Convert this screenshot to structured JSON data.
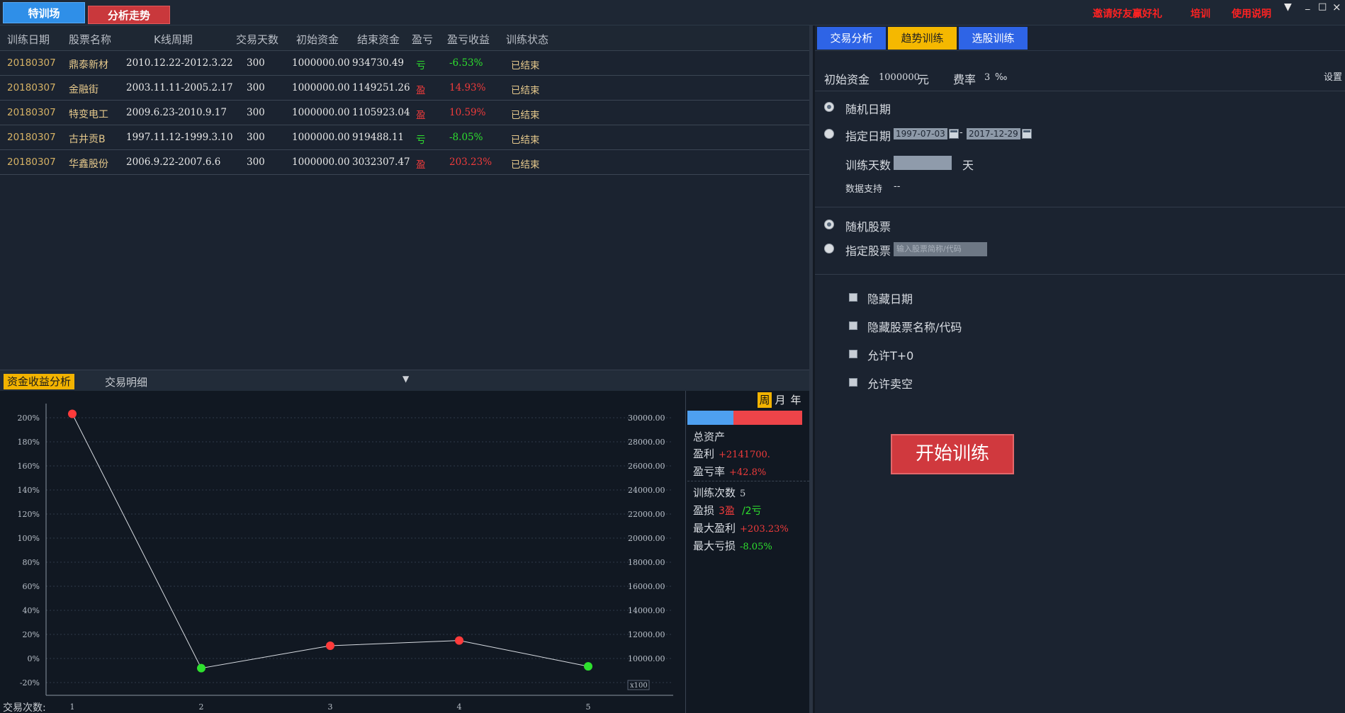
{
  "topbar": {
    "tab_trainer": "特训场",
    "tab_analysis": "分析走势",
    "link_invite": "邀请好友赢好礼",
    "link_training": "培训",
    "link_manual": "使用说明",
    "menu_icon": "chevron-down-icon",
    "minimize": "_",
    "maximize": "□",
    "close": "×"
  },
  "table": {
    "headers": [
      "训练日期",
      "股票名称",
      "K线周期",
      "交易天数",
      "初始资金",
      "结束资金",
      "盈亏",
      "盈亏收益",
      "训练状态"
    ],
    "rows": [
      {
        "date": "20180307",
        "name": "鼎泰新材",
        "period": "2010.12.22-2012.3.22",
        "days": "300",
        "init": "1000000.00",
        "end": "934730.49",
        "pl": "亏",
        "ret": "-6.53%",
        "status": "已结束"
      },
      {
        "date": "20180307",
        "name": "金融街",
        "period": "2003.11.11-2005.2.17",
        "days": "300",
        "init": "1000000.00",
        "end": "1149251.26",
        "pl": "盈",
        "ret": "14.93%",
        "status": "已结束"
      },
      {
        "date": "20180307",
        "name": "特变电工",
        "period": "2009.6.23-2010.9.17",
        "days": "300",
        "init": "1000000.00",
        "end": "1105923.04",
        "pl": "盈",
        "ret": "10.59%",
        "status": "已结束"
      },
      {
        "date": "20180307",
        "name": "古井贡B",
        "period": "1997.11.12-1999.3.10",
        "days": "300",
        "init": "1000000.00",
        "end": "919488.11",
        "pl": "亏",
        "ret": "-8.05%",
        "status": "已结束"
      },
      {
        "date": "20180307",
        "name": "华鑫股份",
        "period": "2006.9.22-2007.6.6",
        "days": "300",
        "init": "1000000.00",
        "end": "3032307.47",
        "pl": "盈",
        "ret": "203.23%",
        "status": "已结束"
      }
    ]
  },
  "bottom_tabs": {
    "fund_analysis": "资金收益分析",
    "trade_detail": "交易明细"
  },
  "chart_data": {
    "type": "line",
    "x": [
      1,
      2,
      3,
      4,
      5
    ],
    "values": [
      203.23,
      -8.05,
      10.59,
      14.93,
      -6.53
    ],
    "point_colors": [
      "#ff3b3b",
      "#2ee02e",
      "#ff3b3b",
      "#ff3b3b",
      "#2ee02e"
    ],
    "y_ticks_left": [
      "200%",
      "180%",
      "160%",
      "140%",
      "120%",
      "100%",
      "80%",
      "60%",
      "40%",
      "20%",
      "0%",
      "-20%"
    ],
    "y_ticks_right": [
      "30000.00",
      "28000.00",
      "26000.00",
      "24000.00",
      "22000.00",
      "20000.00",
      "18000.00",
      "16000.00",
      "14000.00",
      "12000.00",
      "10000.00"
    ],
    "y_unit_right": "x100",
    "x_ticks": [
      "1",
      "2",
      "3",
      "4",
      "5"
    ],
    "xlabel": "交易次数:",
    "ylim": [
      -20,
      210
    ],
    "grid": true
  },
  "stats": {
    "periods": [
      "周",
      "月",
      "年"
    ],
    "total_assets_label": "总资产",
    "profit_label": "盈利",
    "profit_value": "+2141700.",
    "rate_label": "盈亏率",
    "rate_value": "+42.8%",
    "count_label": "训练次数",
    "count_value": "5",
    "winloss_label": "盈损",
    "win_value": "3盈",
    "loss_value": "/2亏",
    "max_profit_label": "最大盈利",
    "max_profit_value": "+203.23%",
    "max_loss_label": "最大亏损",
    "max_loss_value": "-8.05%"
  },
  "right_tabs": {
    "trade_analysis": "交易分析",
    "trend_training": "趋势训练",
    "stock_select": "选股训练"
  },
  "settings": {
    "init_fund_label": "初始资金",
    "init_fund_value": "1000000",
    "init_fund_unit": "元",
    "fee_label": "费率",
    "fee_value": "3",
    "fee_unit": "‰",
    "settings_link": "设置",
    "random_date": "随机日期",
    "specified_date": "指定日期",
    "date_from": "1997-07-03",
    "date_sep": "-",
    "date_to": "2017-12-29",
    "train_days_label": "训练天数",
    "train_days_unit": "天",
    "data_support_label": "数据支持",
    "data_support_value": "--",
    "random_stock": "随机股票",
    "specified_stock": "指定股票",
    "stock_placeholder": "输入股票简称/代码",
    "hide_date": "隐藏日期",
    "hide_name": "隐藏股票名称/代码",
    "allow_t0": "允许T+0",
    "allow_short": "允许卖空",
    "start_button": "开始训练"
  }
}
